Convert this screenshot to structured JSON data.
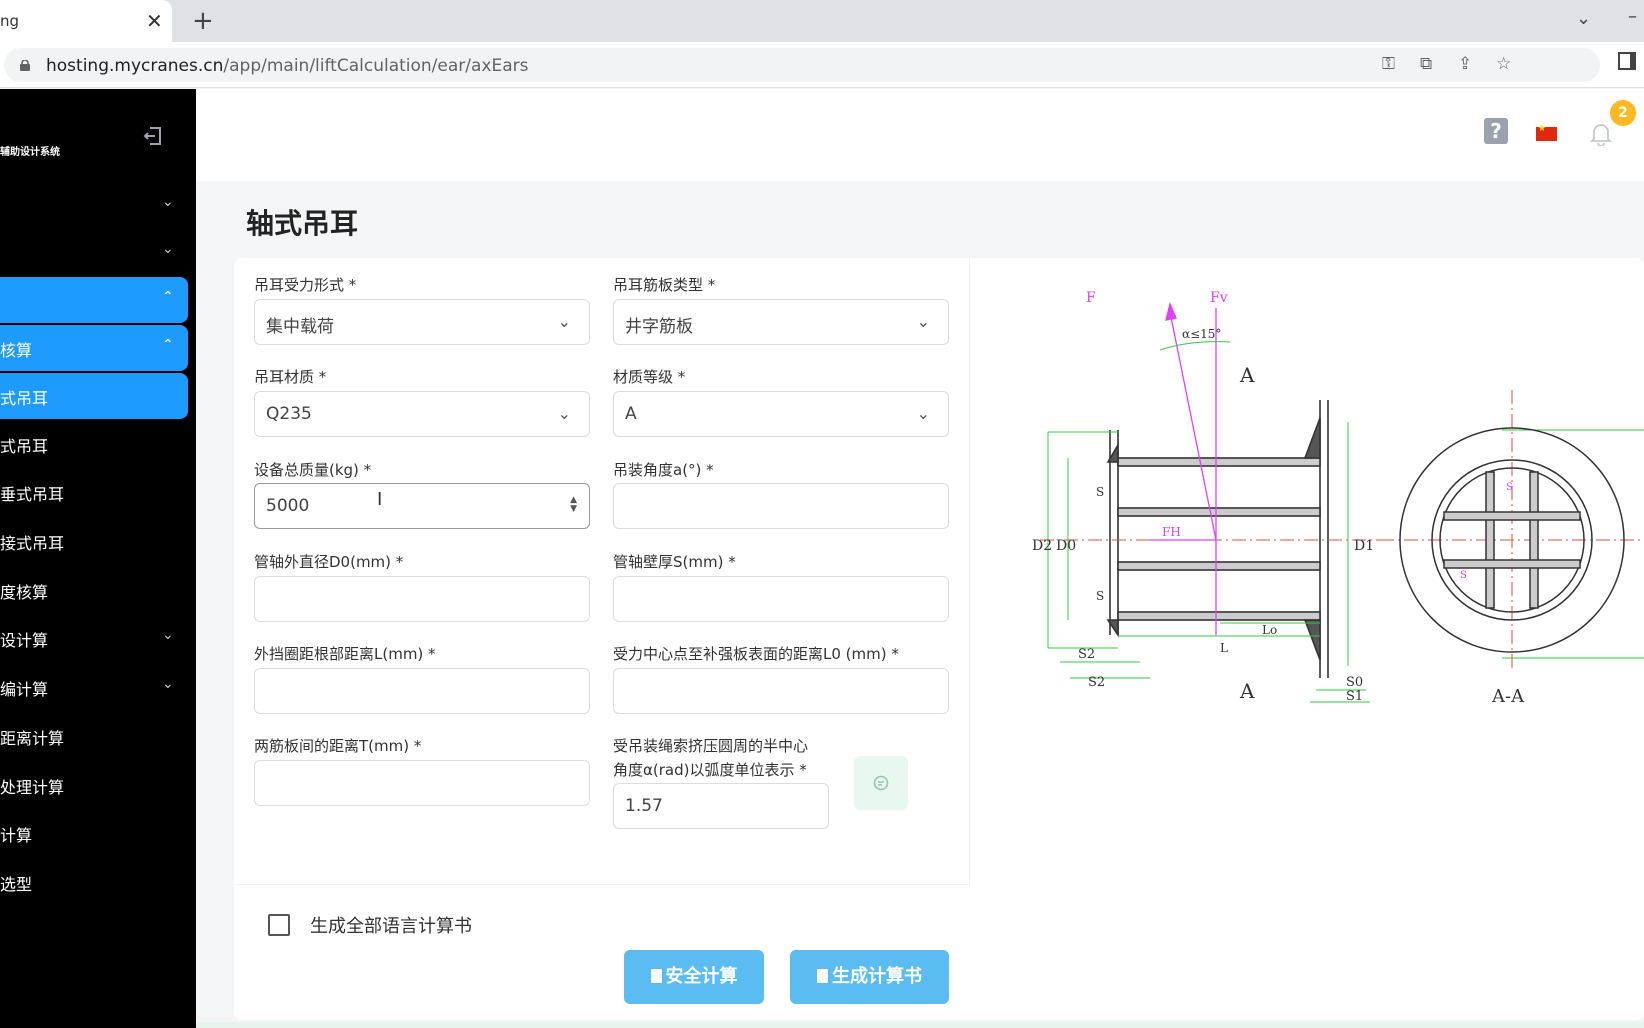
{
  "browser": {
    "tab_title": "ng",
    "tab_close": "✕",
    "new_tab": "+",
    "url_host": "hosting.mycranes.cn",
    "url_path": "/app/main/liftCalculation/ear/axEars"
  },
  "sidebar": {
    "brand": "辅助设计系统",
    "items": [
      {
        "label": "",
        "chevron": "⌄"
      },
      {
        "label": "",
        "chevron": "⌄"
      },
      {
        "label": "",
        "chevron": "⌃"
      },
      {
        "label": "核算",
        "chevron": "⌃"
      },
      {
        "label": "式吊耳",
        "chevron": ""
      },
      {
        "label": "式吊耳",
        "chevron": ""
      },
      {
        "label": "垂式吊耳",
        "chevron": ""
      },
      {
        "label": "接式吊耳",
        "chevron": ""
      },
      {
        "label": "度核算",
        "chevron": ""
      },
      {
        "label": "设计算",
        "chevron": "⌄"
      },
      {
        "label": "编计算",
        "chevron": "⌄"
      },
      {
        "label": "距离计算",
        "chevron": ""
      },
      {
        "label": "处理计算",
        "chevron": ""
      },
      {
        "label": "计算",
        "chevron": ""
      },
      {
        "label": "选型",
        "chevron": ""
      }
    ]
  },
  "header": {
    "help": "?",
    "notification_count": "2"
  },
  "page": {
    "title": "轴式吊耳"
  },
  "form": {
    "load_form": {
      "label": "吊耳受力形式 *",
      "value": "集中载荷"
    },
    "rib_type": {
      "label": "吊耳筋板类型 *",
      "value": "井字筋板"
    },
    "material": {
      "label": "吊耳材质 *",
      "value": "Q235"
    },
    "grade": {
      "label": "材质等级 *",
      "value": "A"
    },
    "total_mass": {
      "label": "设备总质量(kg) *",
      "value": "5000"
    },
    "lift_angle": {
      "label": "吊装角度a(°) *",
      "value": ""
    },
    "shaft_od": {
      "label": "管轴外直径D0(mm) *",
      "value": ""
    },
    "shaft_wall": {
      "label": "管轴壁厚S(mm) *",
      "value": ""
    },
    "ring_dist": {
      "label": "外挡圈距根部距离L(mm) *",
      "value": ""
    },
    "force_center": {
      "label": "受力中心点至补强板表面的距离L0 (mm) *",
      "value": ""
    },
    "rib_spacing": {
      "label": "两筋板间的距离T(mm) *",
      "value": ""
    },
    "half_angle": {
      "label_line1": "受吊装绳索挤压圆周的半中心",
      "label_line2": "角度α(rad)以弧度单位表示 *",
      "value": "1.57"
    }
  },
  "footer": {
    "all_lang_label": "生成全部语言计算书",
    "calc_button": "安全计算",
    "report_button": "生成计算书"
  },
  "drawing": {
    "labels": [
      "F",
      "Fv",
      "α≤15°",
      "A",
      "FH",
      "D2",
      "D0",
      "D1",
      "S",
      "S",
      "Lo",
      "L",
      "S2",
      "S2",
      "A",
      "S0",
      "S1",
      "A-A",
      "S",
      "S"
    ]
  },
  "colors": {
    "accent": "#1e9bff",
    "button": "#5bbcf2",
    "badge": "#fdb822",
    "sidebar_bg": "#000000"
  }
}
